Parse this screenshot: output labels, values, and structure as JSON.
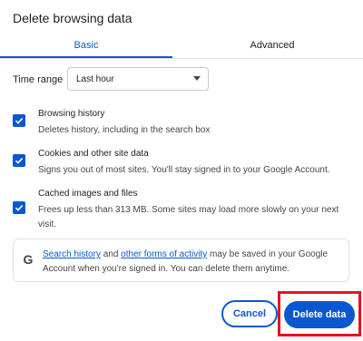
{
  "dialog": {
    "title": "Delete browsing data"
  },
  "tabs": [
    {
      "label": "Basic",
      "selected": true
    },
    {
      "label": "Advanced",
      "selected": false
    }
  ],
  "time_range": {
    "label": "Time range",
    "selected": "Last hour"
  },
  "options": [
    {
      "title": "Browsing history",
      "description": "Deletes history, including in the search box",
      "checked": true
    },
    {
      "title": "Cookies and other site data",
      "description": "Signs you out of most sites. You'll stay signed in to your Google Account.",
      "checked": true
    },
    {
      "title": "Cached images and files",
      "description": "Frees up less than 313 MB. Some sites may load more slowly on your next visit.",
      "checked": true
    }
  ],
  "info": {
    "icon": "google-g-icon",
    "link1": "Search history",
    "text1": " and ",
    "link2": "other forms of activity",
    "text2": " may be saved in your Google Account when you're signed in. You can delete them anytime."
  },
  "buttons": {
    "cancel": "Cancel",
    "delete": "Delete data"
  },
  "colors": {
    "accent": "#0b57d0",
    "highlight": "#e5141b"
  }
}
